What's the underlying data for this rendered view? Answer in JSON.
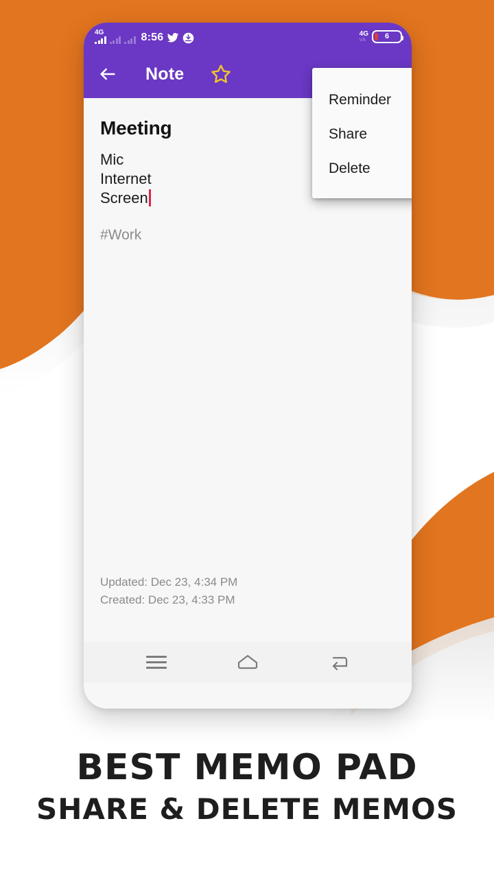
{
  "colors": {
    "orange": "#e2751f",
    "purple": "#6a38c4",
    "note_bg": "#f7f7f7",
    "star_gold": "#f0c22c",
    "caret_red": "#e0244a",
    "battery_red": "#e23b3b",
    "tag_gray": "#8c8c8c",
    "stamp_gray": "#8a8a8a",
    "nav_gray": "#7c7c7c",
    "caption_text": "#1e1e1e"
  },
  "statusbar": {
    "network_label": "4G",
    "time": "8:56",
    "twitter_icon": "twitter-icon",
    "download_icon": "download-icon",
    "right_network_label": "4G",
    "volte_label": "VA",
    "battery_level": "6"
  },
  "appbar": {
    "back_icon": "back-arrow-icon",
    "title": "Note",
    "favorite_icon": "star-outline-icon",
    "overflow_icon": "more-vertical-icon"
  },
  "menu": {
    "items": [
      {
        "label": "Reminder",
        "icon": "alarm-icon"
      },
      {
        "label": "Share",
        "icon": "share-icon"
      },
      {
        "label": "Delete",
        "icon": "trash-icon"
      }
    ]
  },
  "note": {
    "title": "Meeting",
    "body_lines": [
      "Mic",
      "Internet",
      "Screen"
    ],
    "tag": "#Work",
    "updated": "Updated: Dec 23, 4:34 PM",
    "created": "Created: Dec 23, 4:33 PM"
  },
  "navbar": {
    "recents_icon": "menu-icon",
    "home_icon": "home-icon",
    "back_icon": "back-icon"
  },
  "caption": {
    "line1": "BEST MEMO PAD",
    "line2": "SHARE & DELETE MEMOS"
  }
}
